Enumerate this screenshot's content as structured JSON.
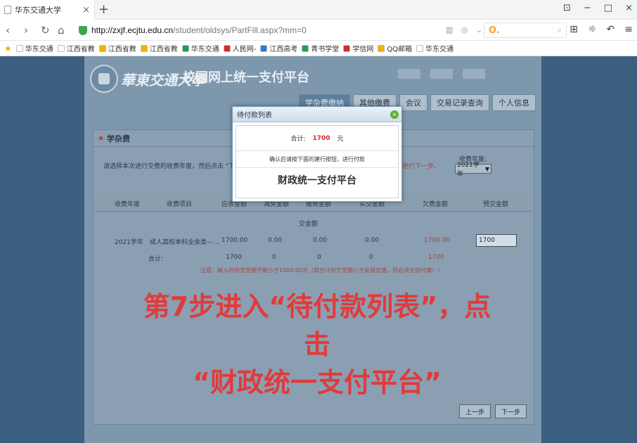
{
  "browser": {
    "tab_title": "华东交通大学",
    "tab_close": "×",
    "new_tab": "+",
    "url_host": "http://zxjf.ecjtu.edu.cn",
    "url_path": "/student/oldsys/PartFill.aspx?mm=0",
    "search_brand": "O.",
    "window_controls": [
      "⊡",
      "−",
      "□",
      "×"
    ],
    "bookmarks": [
      {
        "label": "华东交通",
        "color": "#ffffff"
      },
      {
        "label": "江西省教",
        "color": "#ffffff"
      },
      {
        "label": "江西省教",
        "color": "#f0b400"
      },
      {
        "label": "江西省教",
        "color": "#f0b400"
      },
      {
        "label": "华东交通",
        "color": "#1aa34a"
      },
      {
        "label": "人民网-",
        "color": "#d62b2b"
      },
      {
        "label": "江西高考",
        "color": "#2b7bd6"
      },
      {
        "label": "青书学堂",
        "color": "#1aa34a"
      },
      {
        "label": "学信网",
        "color": "#d62b2b"
      },
      {
        "label": "QQ邮箱",
        "color": "#f0b400"
      },
      {
        "label": "华东交通",
        "color": "#ffffff"
      }
    ]
  },
  "header": {
    "logo_text": "華東交通大學",
    "platform_title": "校园网上统一支付平台",
    "tabs": [
      {
        "label": "学杂费缴纳",
        "active": true
      },
      {
        "label": "其他缴费",
        "active": false
      },
      {
        "label": "会议",
        "active": false
      },
      {
        "label": "交易记录查询",
        "active": false
      },
      {
        "label": "个人信息",
        "active": false
      }
    ]
  },
  "content": {
    "section_title": "学杂费",
    "instruction": "请选择本次进行交费的收费年度，然后点击 \"下一步\" 按",
    "instruction_red": "能进行下一步。",
    "year_label": "收费年度:",
    "year_value": "2021学年",
    "columns": [
      "收费年度",
      "收费项目",
      "应收金额",
      "减免金额",
      "缓免金额",
      "实交金额",
      "欠费金额",
      "预交金额"
    ],
    "subheader": "交金额",
    "row": {
      "year": "2021学年",
      "item": "成人高校本科业余类—...",
      "due": "1700.00",
      "reduce": "0.00",
      "defer": "0.00",
      "paid": "0.00",
      "owed": "1700.00",
      "prepay": "1700"
    },
    "total": {
      "label": "合计:",
      "due": "1700",
      "reduce": "0",
      "defer": "0",
      "paid": "0",
      "owed": "1700"
    },
    "note": "注意：输入的待交金额不能小于1000.00元（若合计所欠金额小于此限定值，则必须全部付清）！",
    "buttons": {
      "prev": "上一步",
      "next": "下一步"
    }
  },
  "overlay": {
    "line1": "第7步进入“待付款列表”，点击",
    "line2": "“财政统一支付平台”"
  },
  "modal": {
    "title": "待付款列表",
    "close": "×",
    "total_label": "合计:",
    "total_amount": "1700",
    "total_unit": "元",
    "confirm_text": "确认后请按下面的建行按钮，进行付款",
    "platform_button": "财政统一支付平台"
  }
}
